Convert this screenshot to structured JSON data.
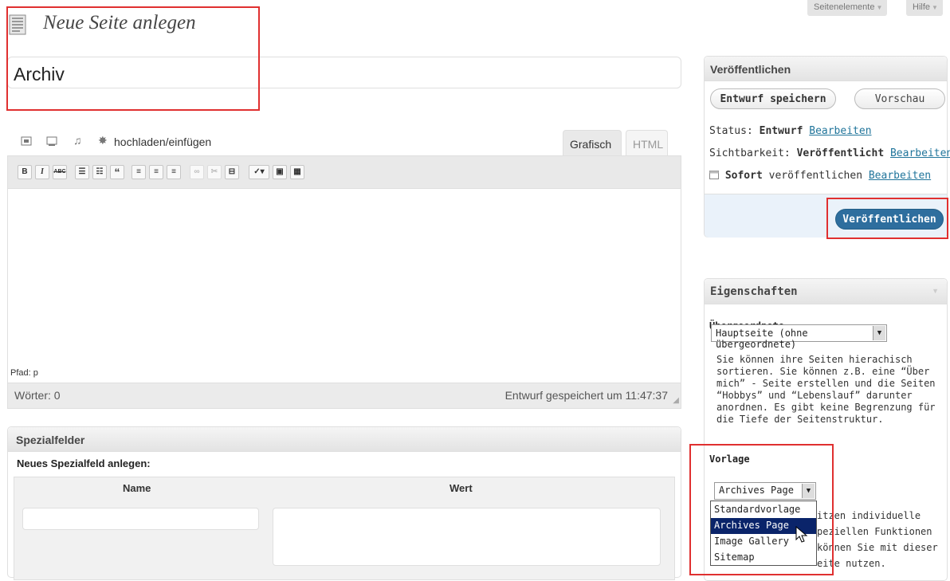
{
  "screen_options": {
    "page_elements_label": "Seitenelemente",
    "help_label": "Hilfe"
  },
  "page": {
    "heading": "Neue Seite anlegen",
    "title_value": "Archiv"
  },
  "media": {
    "upload_label": "hochladen/einfügen"
  },
  "editor": {
    "tab_visual": "Grafisch",
    "tab_html": "HTML",
    "toolbar": {
      "bold": "B",
      "italic": "I",
      "strike": "ABC",
      "blockquote": "“"
    },
    "path": "Pfad: p",
    "word_count": "Wörter: 0",
    "draft_saved": "Entwurf gespeichert um 11:47:37"
  },
  "custom_fields": {
    "title": "Spezialfelder",
    "new_field_label": "Neues Spezialfeld anlegen:",
    "col_name": "Name",
    "col_value": "Wert"
  },
  "publish": {
    "title": "Veröffentlichen",
    "save_draft": "Entwurf speichern",
    "preview": "Vorschau",
    "status_label": "Status:",
    "status_value": "Entwurf",
    "visibility_label": "Sichtbarkeit:",
    "visibility_value": "Veröffentlicht",
    "schedule_value": "Sofort",
    "schedule_suffix": "veröffentlichen",
    "edit_link": "Bearbeiten",
    "publish_button": "Veröffentlichen"
  },
  "attributes": {
    "title": "Eigenschaften",
    "parent_label": "Übergeordnete",
    "parent_value": "Hauptseite (ohne übergeordnete)",
    "parent_help": "Sie können ihre Seiten hierachisch sortieren. Sie können z.B. eine “Über mich” - Seite erstellen und die Seiten “Hobbys” und “Lebenslauf” darunter anordnen. Es gibt keine Begrenzung für die Tiefe der Seitenstruktur.",
    "template_label": "Vorlage",
    "template_value": "Archives Page",
    "template_options": [
      "Standardvorlage",
      "Archives Page",
      "Image Gallery",
      "Sitemap"
    ],
    "template_help_lines": [
      "itzen individuelle",
      "peziellen Funktionen",
      "können Sie mit dieser",
      "eite nutzen."
    ]
  }
}
